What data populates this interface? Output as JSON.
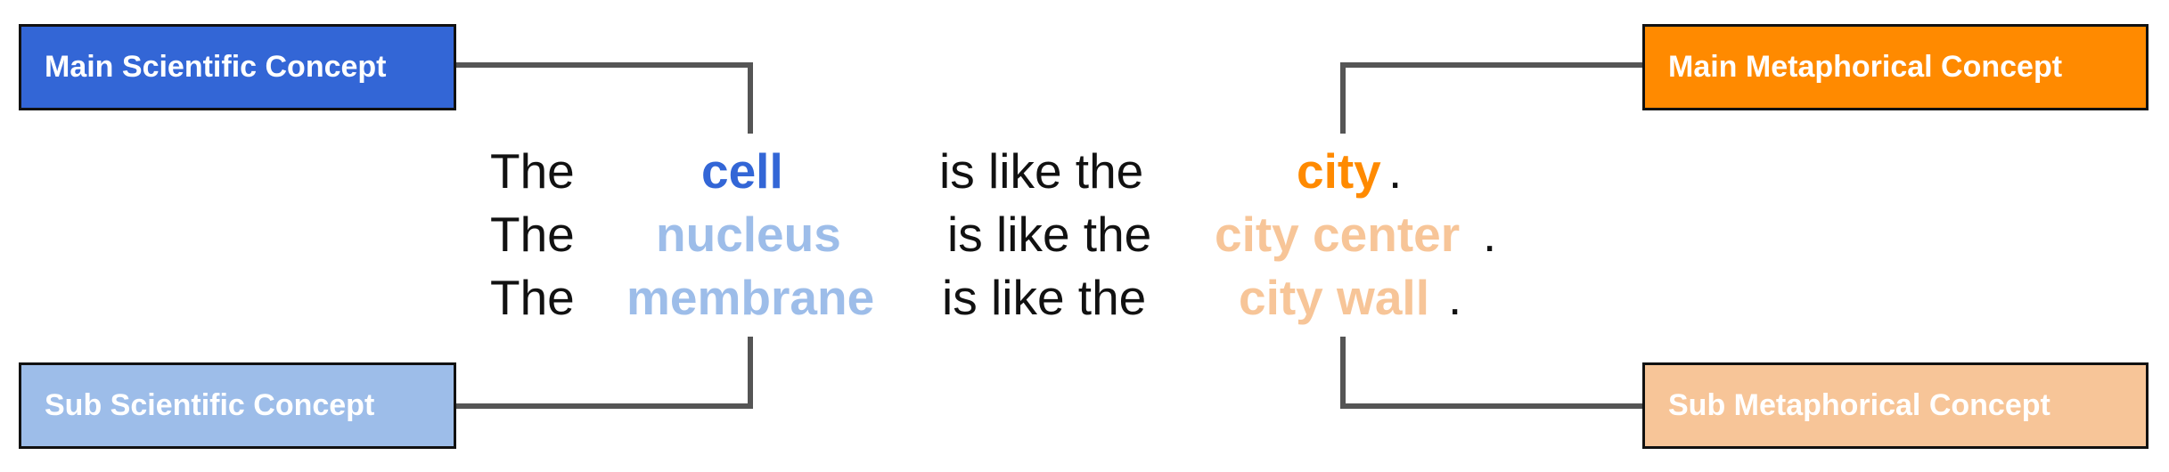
{
  "colors": {
    "main_scientific": "#3366d6",
    "sub_scientific": "#9dbde9",
    "main_metaphorical": "#ff8a00",
    "sub_metaphorical": "#f7c598",
    "connector": "#555555",
    "text": "#111111"
  },
  "boxes": {
    "main_scientific": "Main Scientific Concept",
    "sub_scientific": "Sub Scientific Concept",
    "main_metaphorical": "Main Metaphorical Concept",
    "sub_metaphorical": "Sub Metaphorical Concept"
  },
  "sentences": [
    {
      "article": "The",
      "scientific": "cell",
      "relation": "is like the",
      "metaphor": "city",
      "end": "."
    },
    {
      "article": "The",
      "scientific": "nucleus",
      "relation": "is like the",
      "metaphor": "city center",
      "end": "."
    },
    {
      "article": "The",
      "scientific": "membrane",
      "relation": "is like the",
      "metaphor": "city wall",
      "end": "."
    }
  ]
}
